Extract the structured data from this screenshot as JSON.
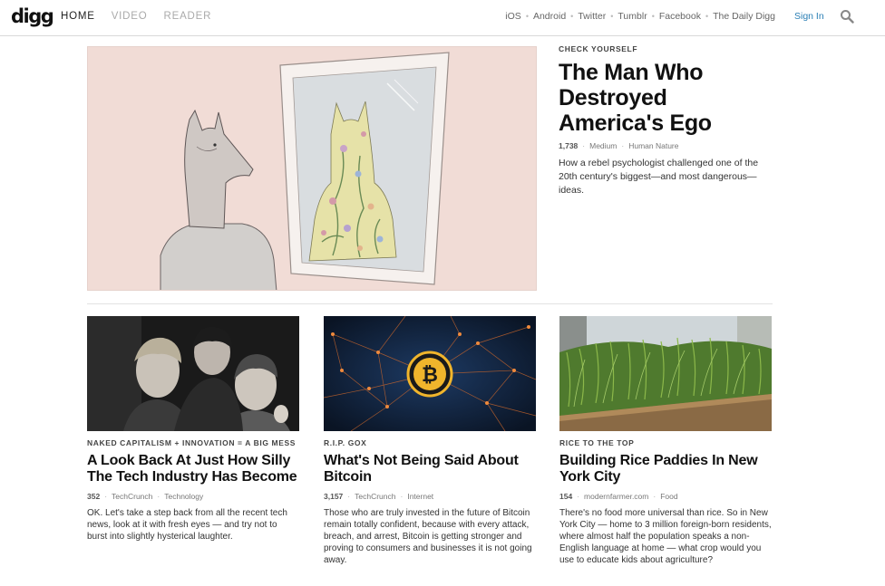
{
  "header": {
    "logo": "digg",
    "nav": [
      "HOME",
      "VIDEO",
      "READER"
    ],
    "links": [
      "iOS",
      "Android",
      "Twitter",
      "Tumblr",
      "Facebook",
      "The Daily Digg"
    ],
    "sign_in": "Sign In",
    "search_icon": "search-icon"
  },
  "hero": {
    "kicker": "CHECK YOURSELF",
    "title": "The Man Who Destroyed America's Ego",
    "count": "1,738",
    "source": "Medium",
    "category": "Human Nature",
    "description": "How a rebel psychologist challenged one of the 20th century's biggest—and most dangerous—ideas."
  },
  "cards": [
    {
      "kicker": "NAKED CAPITALISM + INNOVATION = A BIG MESS",
      "title": "A Look Back At Just How Silly The Tech Industry Has Become",
      "count": "352",
      "source": "TechCrunch",
      "category": "Technology",
      "description": "OK. Let's take a step back from all the recent tech news, look at it with fresh eyes — and try not to burst into slightly hysterical laughter."
    },
    {
      "kicker": "R.I.P. GOX",
      "title": "What's Not Being Said About Bitcoin",
      "count": "3,157",
      "source": "TechCrunch",
      "category": "Internet",
      "description": "Those who are truly invested in the future of Bitcoin remain totally confident, because with every attack, breach, and arrest, Bitcoin is getting stronger and proving to consumers and businesses it is not going away."
    },
    {
      "kicker": "RICE TO THE TOP",
      "title": "Building Rice Paddies In New York City",
      "count": "154",
      "source": "modernfarmer.com",
      "category": "Food",
      "description": "There's no food more universal than rice. So in New York City — home to 3 million foreign-born residents, where almost half the population speaks a non-English language at home — what crop would you use to educate kids about agriculture?"
    }
  ],
  "colors": {
    "accent": "#2a7fb5",
    "hero_bg": "#f1dcd6"
  }
}
